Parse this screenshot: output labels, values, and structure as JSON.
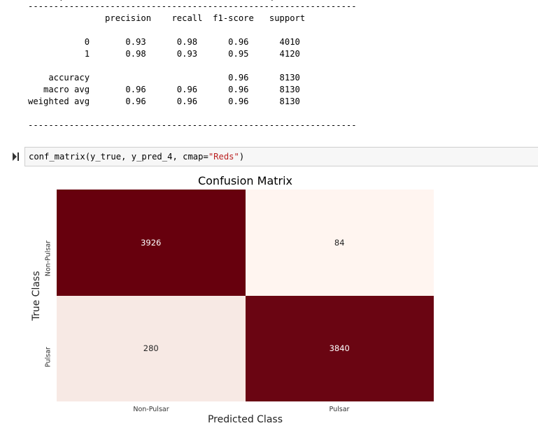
{
  "report": {
    "top_cut_line": "      [                                        ]          ,    ",
    "divider": "----------------------------------------------------------------",
    "header": "               precision    recall  f1-score   support",
    "rows": [
      "           0       0.93      0.98      0.96      4010",
      "           1       0.98      0.93      0.95      4120"
    ],
    "summary": [
      "    accuracy                           0.96      8130",
      "   macro avg       0.96      0.96      0.96      8130",
      "weighted avg       0.96      0.96      0.96      8130"
    ]
  },
  "cell": {
    "code_prefix": "conf_matrix(y_true, y_pred_4, cmap=",
    "code_string": "\"Reds\"",
    "code_suffix": ")"
  },
  "chart_data": {
    "type": "heatmap",
    "title": "Confusion Matrix",
    "xlabel": "Predicted Class",
    "ylabel": "True Class",
    "x_categories": [
      "Non-Pulsar",
      "Pulsar"
    ],
    "y_categories": [
      "Non-Pulsar",
      "Pulsar"
    ],
    "values": [
      [
        3926,
        84
      ],
      [
        280,
        3840
      ]
    ],
    "cmap": "Reds",
    "colors": {
      "dark": "#67000d",
      "dark2": "#6f000e",
      "light": "#fff5f0",
      "light2": "#fee7de",
      "text_on_dark": "#ffffff",
      "text_on_light": "#262626"
    }
  }
}
